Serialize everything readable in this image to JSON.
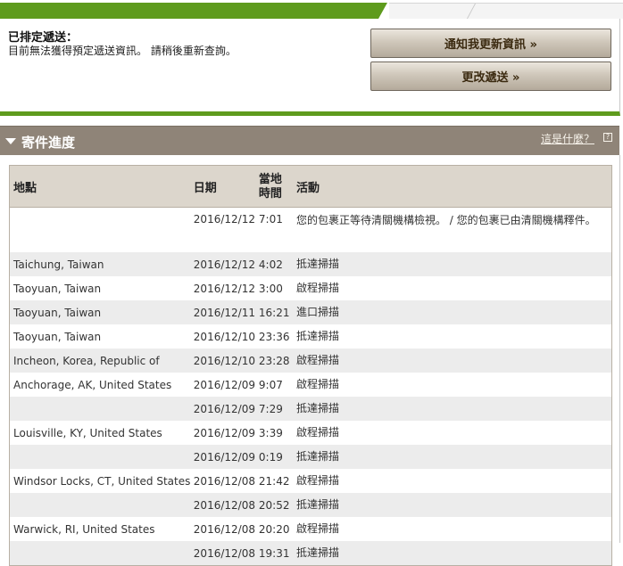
{
  "scheduled": {
    "title": "已排定遞送：",
    "message": "目前無法獲得預定遞送資訊。 請稍後重新查詢。",
    "notify_button": "通知我更新資訊 »",
    "change_button": "更改遞送 »"
  },
  "progress": {
    "title": "寄件進度",
    "help_link": "這是什麼？",
    "help_icon": "?",
    "columns": {
      "location": "地點",
      "date": "日期",
      "time_line1": "當地",
      "time_line2": "時間",
      "activity": "活動"
    },
    "rows": [
      {
        "location": "",
        "date": "2016/12/12",
        "time": "7:01",
        "activity": "您的包裹正等待清關機構檢視。 / 您的包裹已由清關機構釋件。"
      },
      {
        "location": "Taichung, Taiwan",
        "date": "2016/12/12",
        "time": "4:02",
        "activity": "抵達掃描"
      },
      {
        "location": "Taoyuan, Taiwan",
        "date": "2016/12/12",
        "time": "3:00",
        "activity": "啟程掃描"
      },
      {
        "location": "Taoyuan, Taiwan",
        "date": "2016/12/11",
        "time": "16:21",
        "activity": "進口掃描"
      },
      {
        "location": "Taoyuan, Taiwan",
        "date": "2016/12/10",
        "time": "23:36",
        "activity": "抵達掃描"
      },
      {
        "location": "Incheon, Korea, Republic of",
        "date": "2016/12/10",
        "time": "23:28",
        "activity": "啟程掃描"
      },
      {
        "location": "Anchorage, AK, United States",
        "date": "2016/12/09",
        "time": "9:07",
        "activity": "啟程掃描"
      },
      {
        "location": "",
        "date": "2016/12/09",
        "time": "7:29",
        "activity": "抵達掃描"
      },
      {
        "location": "Louisville, KY, United States",
        "date": "2016/12/09",
        "time": "3:39",
        "activity": "啟程掃描"
      },
      {
        "location": "",
        "date": "2016/12/09",
        "time": "0:19",
        "activity": "抵達掃描"
      },
      {
        "location": "Windsor Locks, CT, United States",
        "date": "2016/12/08",
        "time": "21:42",
        "activity": "啟程掃描"
      },
      {
        "location": "",
        "date": "2016/12/08",
        "time": "20:52",
        "activity": "抵達掃描"
      },
      {
        "location": "Warwick, RI, United States",
        "date": "2016/12/08",
        "time": "20:20",
        "activity": "啟程掃描"
      },
      {
        "location": "",
        "date": "2016/12/08",
        "time": "19:31",
        "activity": "抵達掃描"
      }
    ]
  }
}
